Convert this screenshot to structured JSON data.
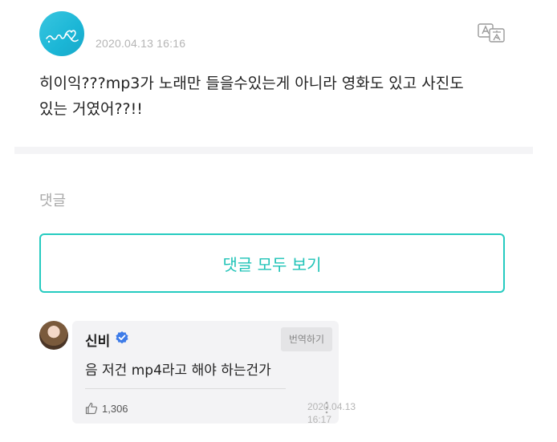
{
  "post": {
    "avatar_icon": "heart-signature-icon",
    "date": "2020.04.13 16:16",
    "translate_icon": "translate-icon",
    "line1": "히이익???mp3가 노래만 들을수있는게 아니라 영화도 있고 사진도",
    "line2": "있는 거였어??!!"
  },
  "comments": {
    "section_label": "댓글",
    "view_all_label": "댓글 모두 보기",
    "accent_color": "#25cbc0",
    "items": [
      {
        "author": "신비",
        "verified": true,
        "translate_label": "번역하기",
        "text": "음 저건 mp4라고 해야 하는건가",
        "like_count": "1,306",
        "date_line1": "2020.04.13",
        "date_line2": "16:17"
      }
    ]
  }
}
